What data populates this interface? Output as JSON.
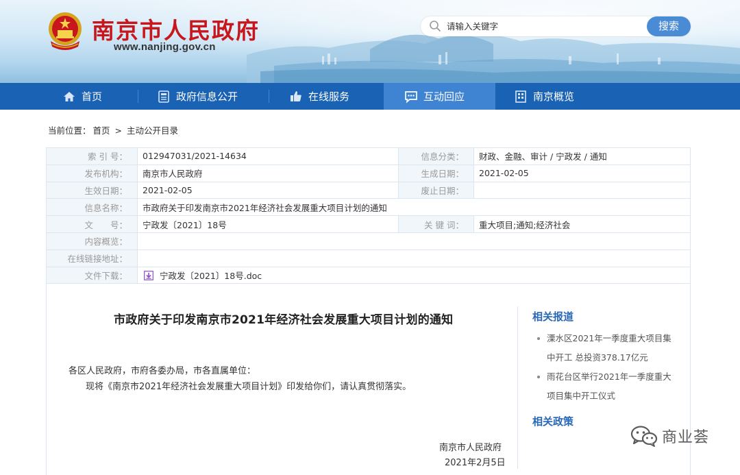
{
  "header": {
    "site_title": "南京市人民政府",
    "site_url": "www.nanjing.gov.cn",
    "logo_icon": "national-emblem-icon",
    "search": {
      "placeholder": "请输入关键字",
      "button_label": "搜索"
    }
  },
  "nav": {
    "items": [
      {
        "label": "首页",
        "icon": "home-icon"
      },
      {
        "label": "政府信息公开",
        "icon": "document-icon"
      },
      {
        "label": "在线服务",
        "icon": "thumbs-up-icon"
      },
      {
        "label": "互动回应",
        "icon": "chat-icon",
        "active": true
      },
      {
        "label": "南京概览",
        "icon": "building-icon"
      }
    ],
    "colors": {
      "bar": "#1a62b4",
      "active": "#3f84d3"
    }
  },
  "breadcrumb": {
    "prefix": "当前位置：",
    "items": [
      "首页",
      "主动公开目录"
    ],
    "separator": ">"
  },
  "info": {
    "index_no_label": "索 引 号：",
    "index_no": "012947031/2021-14634",
    "category_label": "信息分类：",
    "category": "财政、金融、审计 / 宁政发 / 通知",
    "publisher_label": "发布机构：",
    "publisher": "南京市人民政府",
    "created_label": "生成日期：",
    "created": "2021-02-05",
    "effective_label": "生效日期：",
    "effective": "2021-02-05",
    "repealed_label": "废止日期：",
    "repealed": "",
    "name_label": "信息名称：",
    "name": "市政府关于印发南京市2021年经济社会发展重大项目计划的通知",
    "doc_no_label": "文　　号：",
    "doc_no": "宁政发〔2021〕18号",
    "keywords_label": "关 键 词：",
    "keywords": "重大项目;通知;经济社会",
    "summary_label": "内容概览：",
    "summary": "",
    "link_label": "在线链接地址：",
    "link": "",
    "download_label": "文件下载：",
    "download_file": "宁政发〔2021〕18号.doc"
  },
  "document": {
    "title": "市政府关于印发南京市2021年经济社会发展重大项目计划的通知",
    "salutation": "各区人民政府，市府各委办局，市各直属单位：",
    "body": "现将《南京市2021年经济社会发展重大项目计划》印发给你们，请认真贯彻落实。",
    "signer": "南京市人民政府",
    "date": "2021年2月5日"
  },
  "sidebar": {
    "related_reports_heading": "相关报道",
    "related_reports": [
      {
        "line1": "溧水区2021年一季度重大项目集",
        "line2": "中开工 总投资378.17亿元"
      },
      {
        "line1": "雨花台区举行2021年一季度重大",
        "line2": "项目集中开工仪式"
      }
    ],
    "related_policies_heading": "相关政策"
  },
  "watermark": {
    "icon": "wechat-icon",
    "text": "商业荟"
  }
}
